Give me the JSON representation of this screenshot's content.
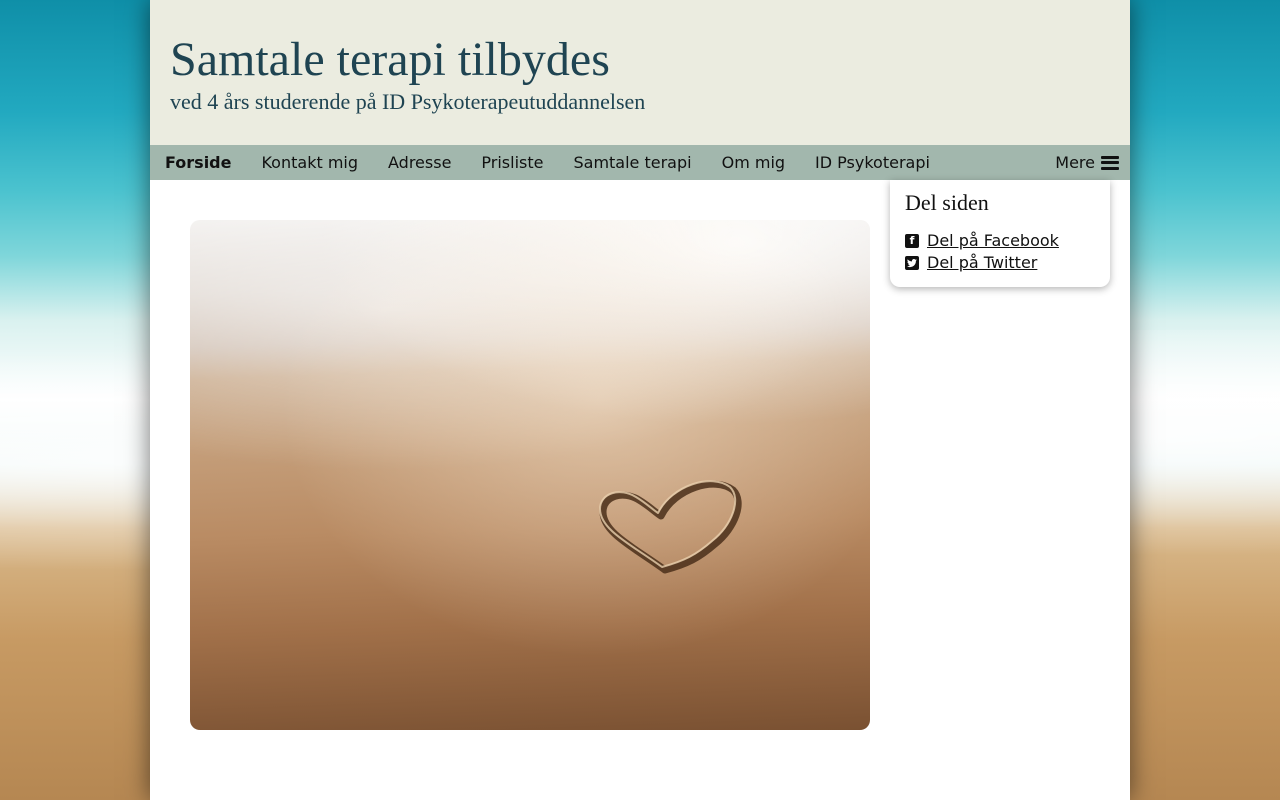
{
  "header": {
    "title": "Samtale terapi tilbydes",
    "subtitle": "ved 4 års studerende på ID Psykoterapeutuddannelsen"
  },
  "nav": {
    "items": [
      {
        "label": "Forside",
        "active": true
      },
      {
        "label": "Kontakt mig",
        "active": false
      },
      {
        "label": "Adresse",
        "active": false
      },
      {
        "label": "Prisliste",
        "active": false
      },
      {
        "label": "Samtale terapi",
        "active": false
      },
      {
        "label": "Om mig",
        "active": false
      },
      {
        "label": "ID Psykoterapi",
        "active": false
      }
    ],
    "more_label": "Mere",
    "more_icon": "hamburger-icon"
  },
  "share": {
    "title": "Del siden",
    "facebook_label": "Del på Facebook",
    "facebook_icon": "facebook-square-icon",
    "twitter_label": "Del på Twitter",
    "twitter_icon": "twitter-square-icon"
  },
  "hero": {
    "image": "heart-in-sand-photo"
  },
  "colors": {
    "header_bg": "#ebece0",
    "title_color": "#1f4452",
    "nav_bg": "#a2b7ad"
  }
}
